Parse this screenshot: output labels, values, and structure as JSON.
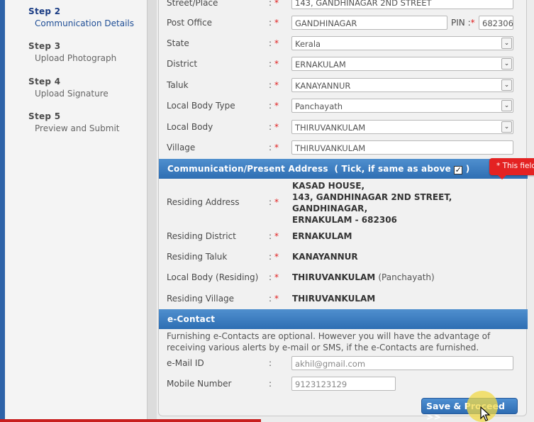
{
  "steps": [
    {
      "num": "Step 2",
      "title": "Communication Details",
      "active": true
    },
    {
      "num": "Step 3",
      "title": "Upload Photograph"
    },
    {
      "num": "Step 4",
      "title": "Upload Signature"
    },
    {
      "num": "Step 5",
      "title": "Preview and Submit"
    }
  ],
  "address": {
    "street_label": "Street/Place",
    "street_value": "143, GANDHINAGAR 2ND STREET",
    "post_office_label": "Post Office",
    "post_office_value": "GANDHINAGAR",
    "pin_label": "PIN :",
    "pin_value": "682306",
    "state_label": "State",
    "state_value": "Kerala",
    "district_label": "District",
    "district_value": "ERNAKULAM",
    "taluk_label": "Taluk",
    "taluk_value": "KANAYANNUR",
    "local_body_type_label": "Local Body Type",
    "local_body_type_value": "Panchayath",
    "local_body_label": "Local Body",
    "local_body_value": "THIRUVANKULAM",
    "village_label": "Village",
    "village_value": "THIRUVANKULAM"
  },
  "present": {
    "section_title": "Communication/Present Address",
    "section_hint": "( Tick, if same as above",
    "section_hint_close": ")",
    "residing_address_label": "Residing Address",
    "residing_address_lines": [
      "KASAD HOUSE,",
      "143, GANDHINAGAR 2ND STREET,",
      "GANDHINAGAR,",
      "ERNAKULAM - 682306"
    ],
    "residing_district_label": "Residing District",
    "residing_district_value": "ERNAKULAM",
    "residing_taluk_label": "Residing Taluk",
    "residing_taluk_value": "KANAYANNUR",
    "local_body_residing_label": "Local Body (Residing)",
    "local_body_residing_value": "THIRUVANKULAM",
    "local_body_residing_type": "(Panchayath)",
    "residing_village_label": "Residing Village",
    "residing_village_value": "THIRUVANKULAM"
  },
  "econtact": {
    "section_title": "e-Contact",
    "note": "Furnishing e-Contacts are optional. However you will have the advantage of receiving various alerts by e-mail or SMS, if the e-Contacts are furnished.",
    "email_label": "e-Mail ID",
    "email_value": "akhil@gmail.com",
    "mobile_label": "Mobile Number",
    "mobile_value": "9123123129"
  },
  "colon": ":",
  "required_mark": "*",
  "tooltip": "* This field",
  "checkmark": "✓",
  "dropdown_arrow": "⌄",
  "proceed_button": "Save & Proceed >>",
  "colors": {
    "accent": "#2e6eb3",
    "required": "#e02020",
    "sidebar_active": "#1a3c84"
  }
}
